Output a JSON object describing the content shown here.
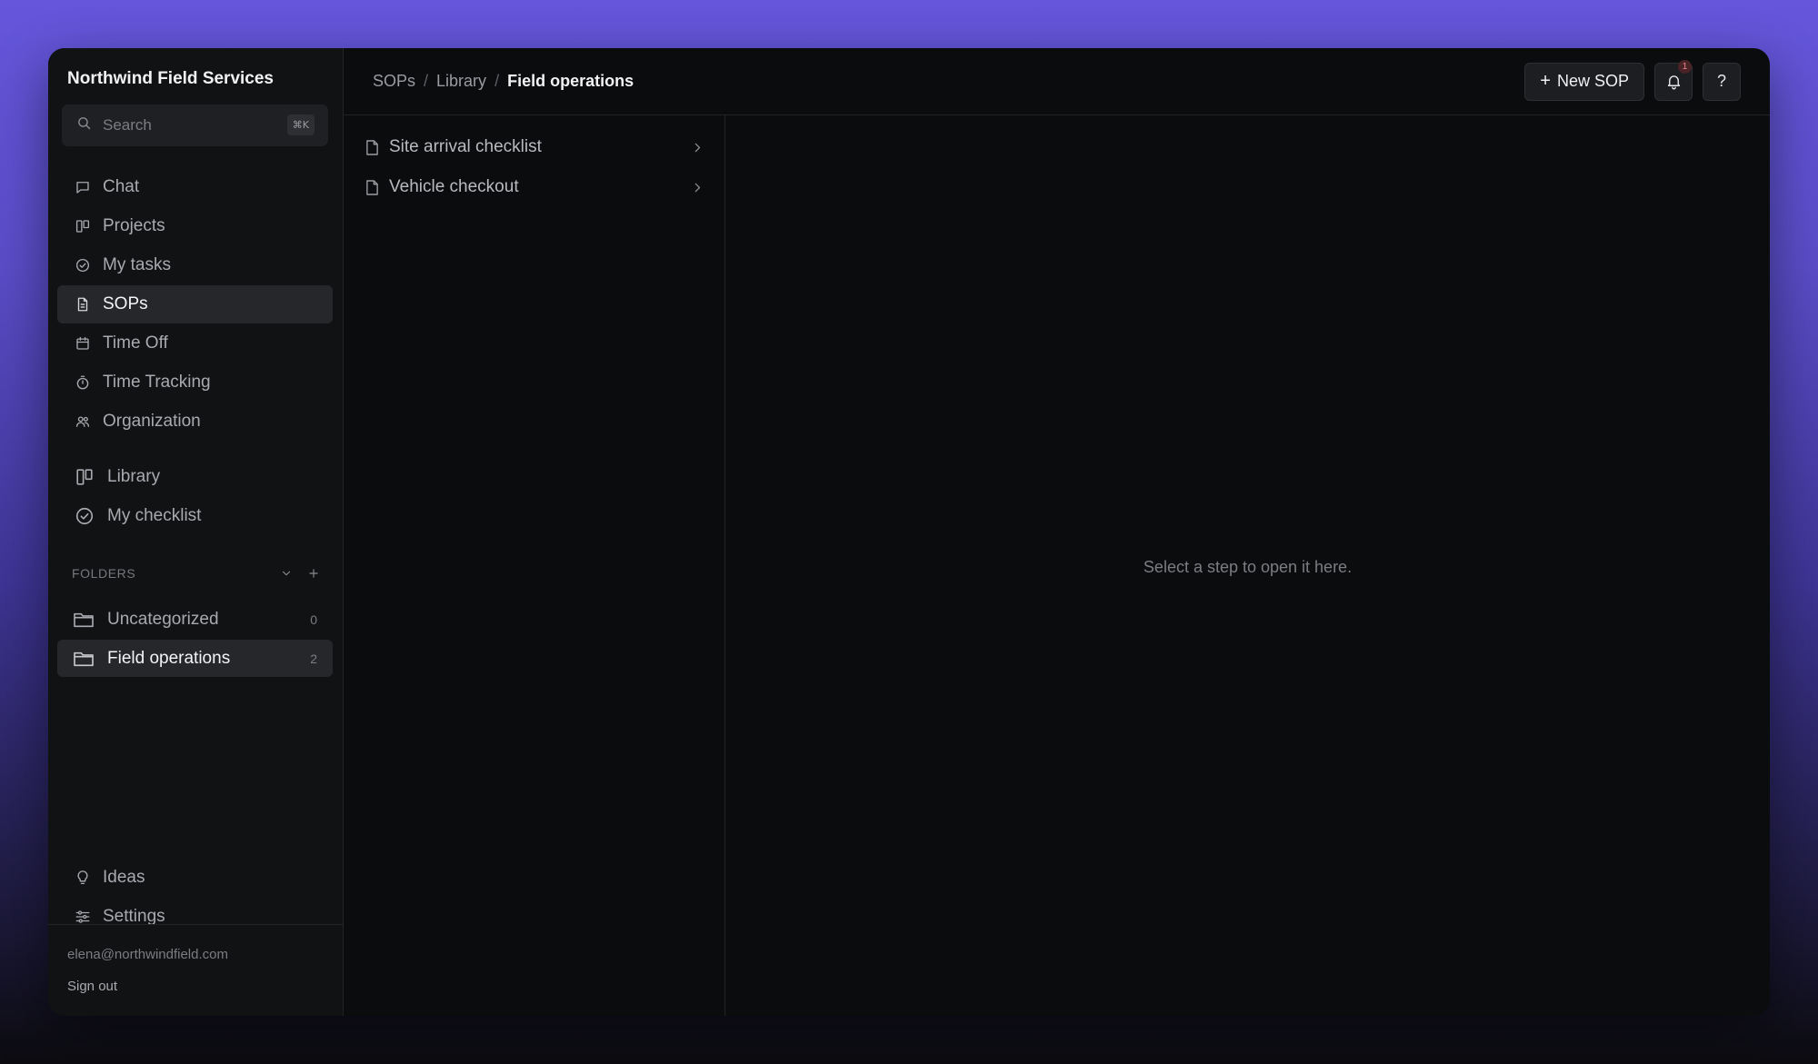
{
  "app": {
    "brand": "Northwind Field Services"
  },
  "search": {
    "placeholder": "Search",
    "shortcut": "⌘K"
  },
  "nav": {
    "items": [
      {
        "label": "Chat",
        "icon": "chat-icon"
      },
      {
        "label": "Projects",
        "icon": "columns-icon"
      },
      {
        "label": "My tasks",
        "icon": "check-circle-icon"
      },
      {
        "label": "SOPs",
        "icon": "document-icon",
        "active": true
      },
      {
        "label": "Time Off",
        "icon": "calendar-icon"
      },
      {
        "label": "Time Tracking",
        "icon": "stopwatch-icon"
      },
      {
        "label": "Organization",
        "icon": "people-icon"
      }
    ]
  },
  "nav2": {
    "items": [
      {
        "label": "Library",
        "icon": "columns-icon"
      },
      {
        "label": "My checklist",
        "icon": "check-circle-icon"
      }
    ]
  },
  "folders": {
    "heading": "FOLDERS",
    "items": [
      {
        "label": "Uncategorized",
        "count": "0"
      },
      {
        "label": "Field operations",
        "count": "2",
        "active": true
      }
    ]
  },
  "bottom_nav": {
    "items": [
      {
        "label": "Ideas",
        "icon": "lightbulb-icon"
      },
      {
        "label": "Settings",
        "icon": "sliders-icon"
      }
    ]
  },
  "account": {
    "email": "elena@northwindfield.com",
    "sign_out": "Sign out"
  },
  "topbar": {
    "breadcrumb": [
      "SOPs",
      "Library",
      "Field operations"
    ],
    "separator": "/",
    "new_button": "New SOP",
    "new_button_plus": "+",
    "notifications_count": "1",
    "help_label": "?"
  },
  "sop_list": {
    "items": [
      {
        "label": "Site arrival checklist"
      },
      {
        "label": "Vehicle checkout"
      }
    ]
  },
  "detail": {
    "placeholder": "Select a step to open it here."
  },
  "colors": {
    "accent_bg_top": "#6556db",
    "surface": "#0b0c0e",
    "sidebar": "#111214",
    "active_item": "#26272b"
  }
}
